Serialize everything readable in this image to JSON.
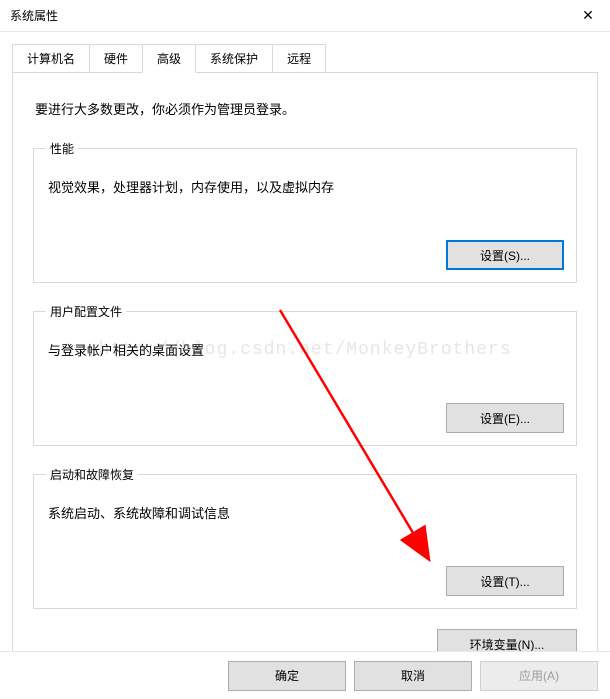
{
  "window": {
    "title": "系统属性",
    "close_glyph": "✕"
  },
  "tabs": {
    "computer_name": "计算机名",
    "hardware": "硬件",
    "advanced": "高级",
    "system_protection": "系统保护",
    "remote": "远程"
  },
  "intro": "要进行大多数更改，你必须作为管理员登录。",
  "groups": {
    "performance": {
      "legend": "性能",
      "desc": "视觉效果，处理器计划，内存使用，以及虚拟内存",
      "button": "设置(S)..."
    },
    "user_profiles": {
      "legend": "用户配置文件",
      "desc": "与登录帐户相关的桌面设置",
      "button": "设置(E)..."
    },
    "startup": {
      "legend": "启动和故障恢复",
      "desc": "系统启动、系统故障和调试信息",
      "button": "设置(T)..."
    }
  },
  "env_button": "环境变量(N)...",
  "footer": {
    "ok": "确定",
    "cancel": "取消",
    "apply": "应用(A)"
  },
  "watermark": "http://blog.csdn.net/MonkeyBrothers"
}
